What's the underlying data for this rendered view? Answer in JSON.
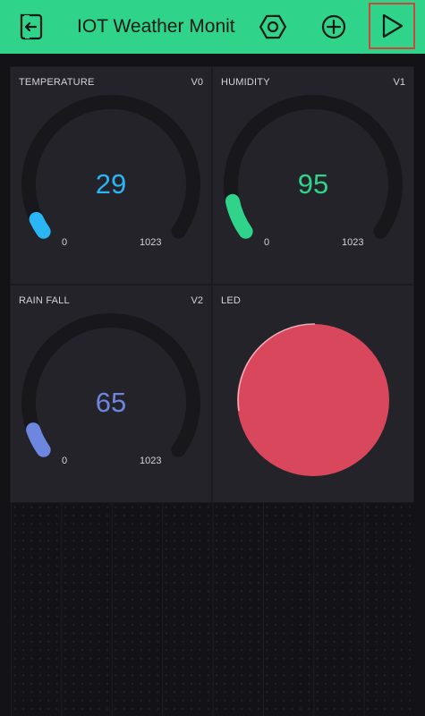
{
  "header": {
    "title": "IOT Weather Monit",
    "icons": [
      "exit-icon",
      "settings-hex-icon",
      "add-widget-icon",
      "play-icon"
    ],
    "color": "#2fd48a"
  },
  "widgets": [
    {
      "title": "TEMPERATURE",
      "pin": "V0",
      "value": "29",
      "min": "0",
      "max": "1023",
      "color": "#2ab5f5"
    },
    {
      "title": "HUMIDITY",
      "pin": "V1",
      "value": "95",
      "min": "0",
      "max": "1023",
      "color": "#2fd48a"
    },
    {
      "title": "RAIN FALL",
      "pin": "V2",
      "value": "65",
      "min": "0",
      "max": "1023",
      "color": "#6d86e0"
    },
    {
      "title": "LED",
      "color": "#d9475c"
    }
  ]
}
